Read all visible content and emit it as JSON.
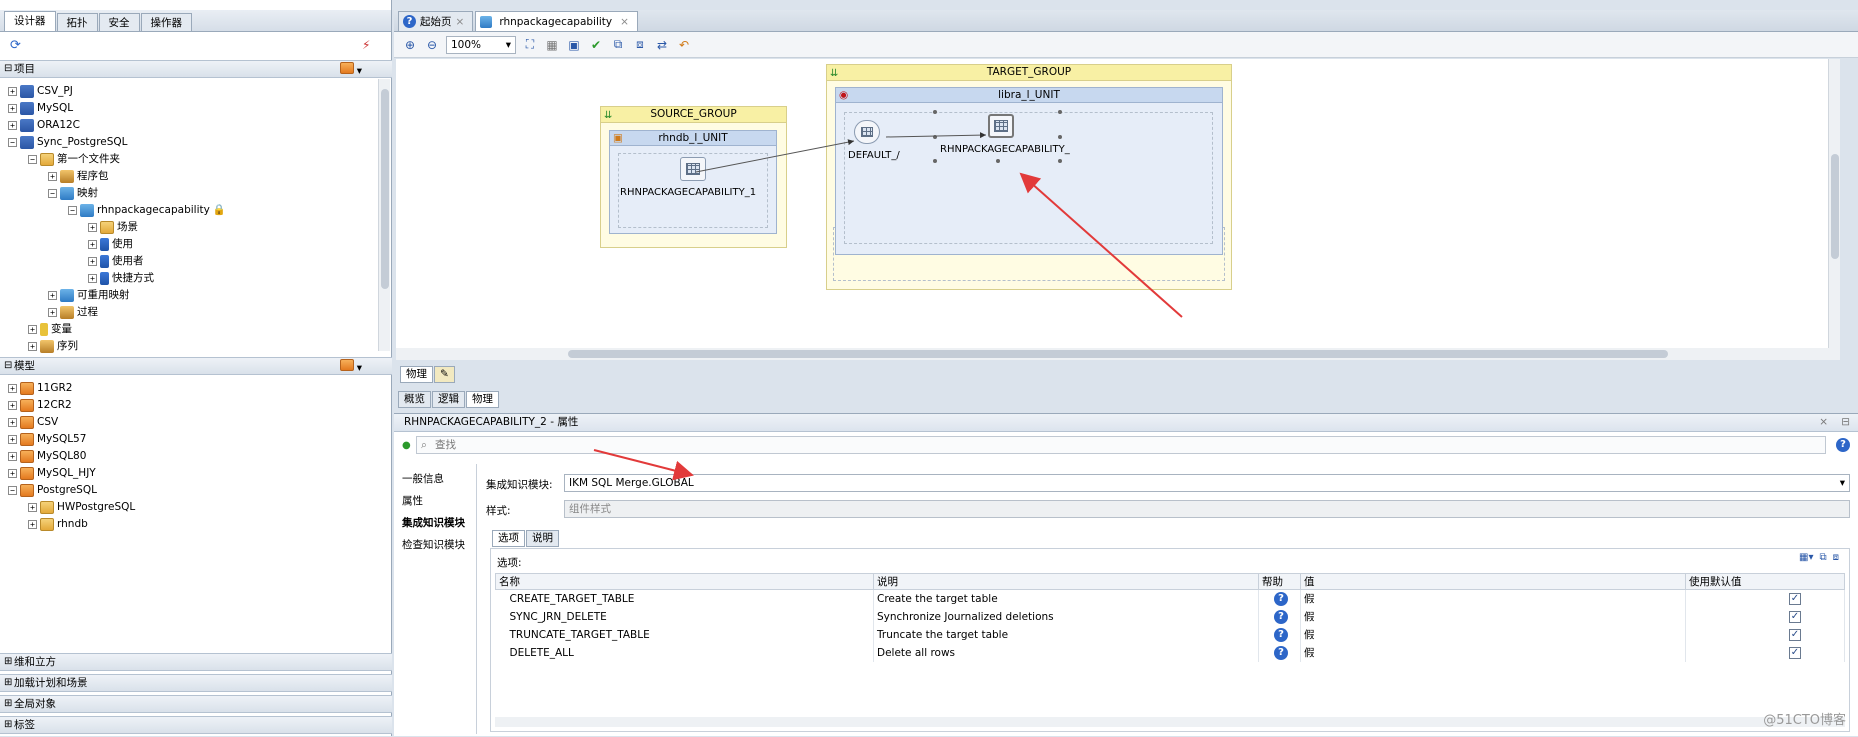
{
  "left": {
    "tabs": [
      "设计器",
      "拓扑",
      "安全",
      "操作器"
    ],
    "projects_label": "项目",
    "project_tree": [
      {
        "label": "CSV_PJ"
      },
      {
        "label": "MySQL"
      },
      {
        "label": "ORA12C"
      },
      {
        "label": "Sync_PostgreSQL"
      },
      {
        "label": "第一个文件夹"
      },
      {
        "label": "程序包"
      },
      {
        "label": "映射"
      },
      {
        "label": "rhnpackagecapability"
      },
      {
        "label": "场景"
      },
      {
        "label": "使用"
      },
      {
        "label": "使用者"
      },
      {
        "label": "快捷方式"
      },
      {
        "label": "可重用映射"
      },
      {
        "label": "过程"
      },
      {
        "label": "变量"
      },
      {
        "label": "序列"
      }
    ],
    "models_label": "模型",
    "model_tree": [
      {
        "label": "11GR2"
      },
      {
        "label": "12CR2"
      },
      {
        "label": "CSV"
      },
      {
        "label": "MySQL57"
      },
      {
        "label": "MySQL80"
      },
      {
        "label": "MySQL_HJY"
      },
      {
        "label": "PostgreSQL"
      },
      {
        "label": "HWPostgreSQL"
      },
      {
        "label": "rhndb"
      }
    ],
    "bottom_sections": [
      "维和立方",
      "加载计划和场景",
      "全局对象",
      "标签"
    ]
  },
  "editor": {
    "tabs": [
      {
        "label": "起始页"
      },
      {
        "label": "rhnpackagecapability"
      }
    ],
    "zoom": "100%"
  },
  "diagram": {
    "source_group": "SOURCE_GROUP",
    "source_unit": "rhndb_l_UNIT",
    "source_node": "RHNPACKAGECAPABILITY_1",
    "target_group": "TARGET_GROUP",
    "target_unit": "libra_l_UNIT",
    "target_default": "DEFAULT_/",
    "target_node": "RHNPACKAGECAPABILITY_"
  },
  "view_tabs": [
    "物理",
    "概览",
    "逻辑",
    "物理"
  ],
  "properties": {
    "title": "RHNPACKAGECAPABILITY_2 - 属性",
    "search_placeholder": "查找",
    "nav": [
      "一般信息",
      "属性",
      "集成知识模块",
      "检查知识模块"
    ],
    "ikm_label": "集成知识模块:",
    "ikm_value": "IKM SQL Merge.GLOBAL",
    "style_label": "样式:",
    "style_value": "组件样式",
    "inner_tabs": [
      "选项",
      "说明"
    ],
    "options_label": "选项:",
    "columns": [
      "名称",
      "说明",
      "帮助",
      "值",
      "使用默认值"
    ],
    "rows": [
      {
        "name": "CREATE_TARGET_TABLE",
        "desc": "Create the target table",
        "value": "假",
        "default": true
      },
      {
        "name": "SYNC_JRN_DELETE",
        "desc": "Synchronize Journalized deletions",
        "value": "假",
        "default": true
      },
      {
        "name": "TRUNCATE_TARGET_TABLE",
        "desc": "Truncate the target table",
        "value": "假",
        "default": true
      },
      {
        "name": "DELETE_ALL",
        "desc": "Delete all rows",
        "value": "假",
        "default": true
      }
    ]
  },
  "watermark": "@51CTO博客"
}
